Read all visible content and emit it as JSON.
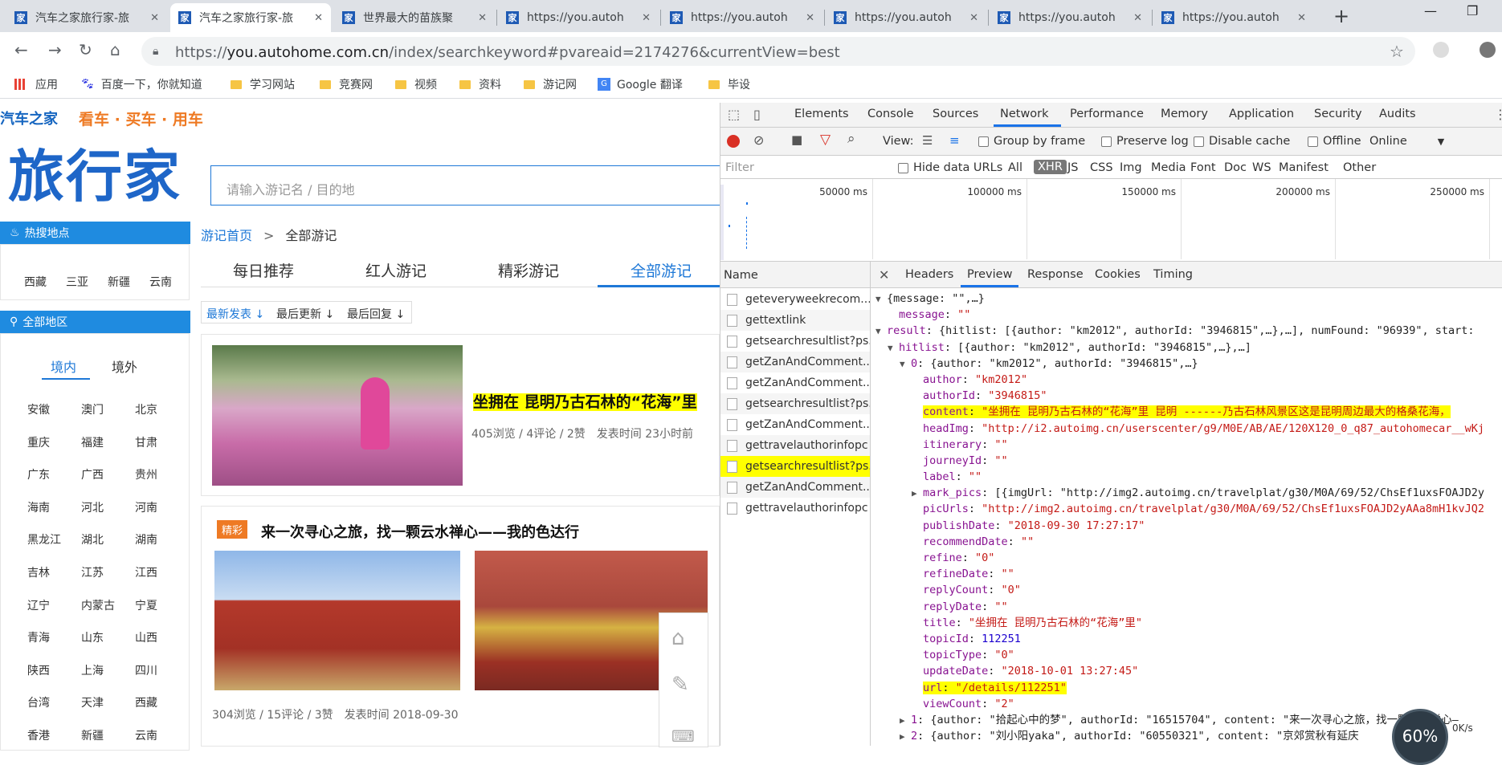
{
  "tabs": [
    {
      "title": "汽车之家旅行家-旅",
      "active": false
    },
    {
      "title": "汽车之家旅行家-旅",
      "active": true
    },
    {
      "title": "世界最大的苗族聚",
      "active": false
    },
    {
      "title": "https://you.autoh",
      "active": false
    },
    {
      "title": "https://you.autoh",
      "active": false
    },
    {
      "title": "https://you.autoh",
      "active": false
    },
    {
      "title": "https://you.autoh",
      "active": false
    },
    {
      "title": "https://you.autoh",
      "active": false
    }
  ],
  "favicon": "家",
  "address": {
    "prefix": "https://",
    "host": "you.autohome.com.cn",
    "path": "/index/searchkeyword#pvareaid=2174276&currentView=best"
  },
  "bookmarks": [
    "应用",
    "百度一下，你就知道",
    "学习网站",
    "竞赛网",
    "视频",
    "资料",
    "游记网",
    "Google 翻译",
    "毕设"
  ],
  "site": {
    "logo": "汽车之家",
    "slogan": "看车 · 买车 · 用车",
    "brand": "旅行家",
    "search_placeholder": "请输入游记名 / 目的地",
    "hot_title": "热搜地点",
    "hot": [
      "西藏",
      "三亚",
      "新疆",
      "云南"
    ],
    "all_title": "全部地区",
    "region_tabs": [
      "境内",
      "境外"
    ],
    "regions": [
      [
        "安徽",
        "澳门",
        "北京"
      ],
      [
        "重庆",
        "福建",
        "甘肃"
      ],
      [
        "广东",
        "广西",
        "贵州"
      ],
      [
        "海南",
        "河北",
        "河南"
      ],
      [
        "黑龙江",
        "湖北",
        "湖南"
      ],
      [
        "吉林",
        "江苏",
        "江西"
      ],
      [
        "辽宁",
        "内蒙古",
        "宁夏"
      ],
      [
        "青海",
        "山东",
        "山西"
      ],
      [
        "陕西",
        "上海",
        "四川"
      ],
      [
        "台湾",
        "天津",
        "西藏"
      ],
      [
        "香港",
        "新疆",
        "云南"
      ]
    ],
    "breadcrumb": {
      "home": "游记首页",
      "sep": ">",
      "current": "全部游记"
    },
    "nav": [
      "每日推荐",
      "红人游记",
      "精彩游记",
      "全部游记"
    ],
    "sort": [
      "最新发表 ↓",
      "最后更新 ↓",
      "最后回复 ↓"
    ],
    "card1": {
      "title": "坐拥在 昆明乃古石林的“花海”里",
      "meta": "405浏览 / 4评论 / 2赞　发表时间  23小时前"
    },
    "card2": {
      "badge": "精彩",
      "title": "来一次寻心之旅，找一颗云水禅心——我的色达行",
      "meta": "304浏览 / 15评论 / 3赞　发表时间  2018-09-30"
    }
  },
  "devtools": {
    "tabs": [
      "Elements",
      "Console",
      "Sources",
      "Network",
      "Performance",
      "Memory",
      "Application",
      "Security",
      "Audits"
    ],
    "active_tab": "Network",
    "view_label": "View:",
    "options": [
      "Group by frame",
      "Preserve log",
      "Disable cache",
      "Offline"
    ],
    "throttle": "Online",
    "filter_placeholder": "Filter",
    "hide_data_urls": "Hide data URLs",
    "types": [
      "All",
      "XHR",
      "JS",
      "CSS",
      "Img",
      "Media",
      "Font",
      "Doc",
      "WS",
      "Manifest",
      "Other"
    ],
    "active_type": "XHR",
    "timeline_labels": [
      "50000 ms",
      "100000 ms",
      "150000 ms",
      "200000 ms",
      "250000 ms"
    ],
    "name_header": "Name",
    "requests": [
      "geteveryweekrecom...",
      "gettextlink",
      "getsearchresultlist?ps...",
      "getZanAndComment...",
      "getZanAndComment...",
      "getsearchresultlist?ps...",
      "getZanAndComment...",
      "gettravelauthorinfopc",
      "getsearchresultlist?ps...",
      "getZanAndComment...",
      "gettravelauthorinfopc"
    ],
    "selected_request": 8,
    "detail_tabs": [
      "Headers",
      "Preview",
      "Response",
      "Cookies",
      "Timing"
    ],
    "active_detail": "Preview",
    "preview": [
      {
        "i": 0,
        "t": "▼",
        "k": "",
        "v": "{message: \"\",…}",
        "c": "p"
      },
      {
        "i": 1,
        "t": "",
        "k": "message",
        "v": "\"\"",
        "c": "s"
      },
      {
        "i": 0,
        "t": "▼",
        "k": "result",
        "v": "{hitlist: [{author: \"km2012\", authorId: \"3946815\",…},…], numFound: \"96939\", start:",
        "c": "p"
      },
      {
        "i": 1,
        "t": "▼",
        "k": "hitlist",
        "v": "[{author: \"km2012\", authorId: \"3946815\",…},…]",
        "c": "p"
      },
      {
        "i": 2,
        "t": "▼",
        "k": "0",
        "v": "{author: \"km2012\", authorId: \"3946815\",…}",
        "c": "p"
      },
      {
        "i": 3,
        "t": "",
        "k": "author",
        "v": "\"km2012\"",
        "c": "s"
      },
      {
        "i": 3,
        "t": "",
        "k": "authorId",
        "v": "\"3946815\"",
        "c": "s"
      },
      {
        "i": 3,
        "t": "",
        "k": "content",
        "v": "\"坐拥在 昆明乃古石林的“花海”里 昆明 ------乃古石林风景区这是昆明周边最大的格桑花海，",
        "c": "s",
        "hl": true
      },
      {
        "i": 3,
        "t": "",
        "k": "headImg",
        "v": "\"http://i2.autoimg.cn/userscenter/g9/M0E/AB/AE/120X120_0_q87_autohomecar__wKj",
        "c": "s"
      },
      {
        "i": 3,
        "t": "",
        "k": "itinerary",
        "v": "\"\"",
        "c": "s"
      },
      {
        "i": 3,
        "t": "",
        "k": "journeyId",
        "v": "\"\"",
        "c": "s"
      },
      {
        "i": 3,
        "t": "",
        "k": "label",
        "v": "\"\"",
        "c": "s"
      },
      {
        "i": 3,
        "t": "▶",
        "k": "mark_pics",
        "v": "[{imgUrl: \"http://img2.autoimg.cn/travelplat/g30/M0A/69/52/ChsEf1uxsFOAJD2y",
        "c": "p"
      },
      {
        "i": 3,
        "t": "",
        "k": "picUrls",
        "v": "\"http://img2.autoimg.cn/travelplat/g30/M0A/69/52/ChsEf1uxsFOAJD2yAAa8mH1kvJQ2",
        "c": "s"
      },
      {
        "i": 3,
        "t": "",
        "k": "publishDate",
        "v": "\"2018-09-30 17:27:17\"",
        "c": "s"
      },
      {
        "i": 3,
        "t": "",
        "k": "recommendDate",
        "v": "\"\"",
        "c": "s"
      },
      {
        "i": 3,
        "t": "",
        "k": "refine",
        "v": "\"0\"",
        "c": "s"
      },
      {
        "i": 3,
        "t": "",
        "k": "refineDate",
        "v": "\"\"",
        "c": "s"
      },
      {
        "i": 3,
        "t": "",
        "k": "replyCount",
        "v": "\"0\"",
        "c": "s"
      },
      {
        "i": 3,
        "t": "",
        "k": "replyDate",
        "v": "\"\"",
        "c": "s"
      },
      {
        "i": 3,
        "t": "",
        "k": "title",
        "v": "\"坐拥在 昆明乃古石林的“花海”里\"",
        "c": "s"
      },
      {
        "i": 3,
        "t": "",
        "k": "topicId",
        "v": "112251",
        "c": "n"
      },
      {
        "i": 3,
        "t": "",
        "k": "topicType",
        "v": "\"0\"",
        "c": "s"
      },
      {
        "i": 3,
        "t": "",
        "k": "updateDate",
        "v": "\"2018-10-01 13:27:45\"",
        "c": "s"
      },
      {
        "i": 3,
        "t": "",
        "k": "url",
        "v": "\"/details/112251\"",
        "c": "s",
        "hl": true
      },
      {
        "i": 3,
        "t": "",
        "k": "viewCount",
        "v": "\"2\"",
        "c": "s"
      },
      {
        "i": 2,
        "t": "▶",
        "k": "1",
        "v": "{author: \"拾起心中的梦\", authorId: \"16515704\", content: \"来一次寻心之旅，找一颗云水禅心—",
        "c": "p"
      },
      {
        "i": 2,
        "t": "▶",
        "k": "2",
        "v": "{author: \"刘小阳yaka\", authorId: \"60550321\", content: \"京郊赏秋有延庆",
        "c": "p"
      }
    ],
    "net_widget": {
      "percent": "60%",
      "rate": "0K/s"
    }
  }
}
